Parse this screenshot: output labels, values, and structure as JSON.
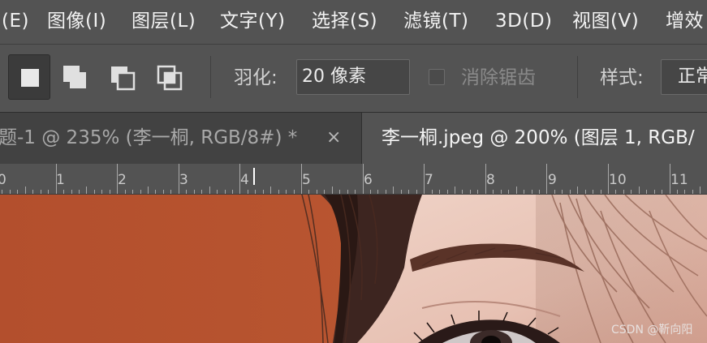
{
  "menubar": {
    "items": [
      "(E)",
      "图像(I)",
      "图层(L)",
      "文字(Y)",
      "选择(S)",
      "滤镜(T)",
      "3D(D)",
      "视图(V)",
      "增效"
    ]
  },
  "options": {
    "feather_label": "羽化:",
    "feather_value": "20 像素",
    "antialias_label": "消除锯齿",
    "antialias_checked": false,
    "style_label": "样式:",
    "style_value": "正常",
    "selection_modes": [
      "new-selection",
      "add-to-selection",
      "subtract-from-selection",
      "intersect-with-selection"
    ],
    "active_mode": "new-selection"
  },
  "tabs": [
    {
      "title": "题-1 @ 235% (李一桐, RGB/8#) *",
      "close": "×",
      "active": false
    },
    {
      "title": "李一桐.jpeg @ 200% (图层 1, RGB/",
      "active": true
    }
  ],
  "ruler": {
    "labels": [
      "0",
      "1",
      "2",
      "3",
      "4",
      "5",
      "6",
      "7",
      "8",
      "9",
      "10",
      "11"
    ]
  },
  "watermark": "CSDN @靳向阳",
  "colors": {
    "panel": "#535353",
    "tabbar": "#424242",
    "canvas_background": "#b5502d"
  }
}
